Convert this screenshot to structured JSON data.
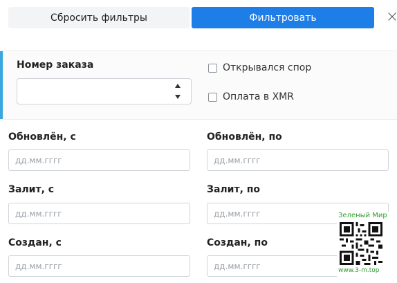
{
  "toolbar": {
    "reset_label": "Сбросить фильтры",
    "apply_label": "Фильтровать",
    "close_symbol": "×"
  },
  "order": {
    "label": "Номер заказа",
    "value": ""
  },
  "checkboxes": {
    "dispute_label": "Открывался спор",
    "xmr_label": "Оплата в XMR"
  },
  "filters": {
    "updated_from_label": "Обновлён, с",
    "updated_to_label": "Обновлён, по",
    "filled_from_label": "Залит, с",
    "filled_to_label": "Залит, по",
    "created_from_label": "Создан, с",
    "created_to_label": "Создан, по",
    "date_placeholder": "дд.мм.гггг"
  },
  "watermark": {
    "top_text": "Зеленый Мир",
    "bottom_text": "www.3-m.top"
  },
  "colors": {
    "primary": "#1e7ee8",
    "accent": "#3aa6dd",
    "watermark": "#2e9c2e"
  }
}
